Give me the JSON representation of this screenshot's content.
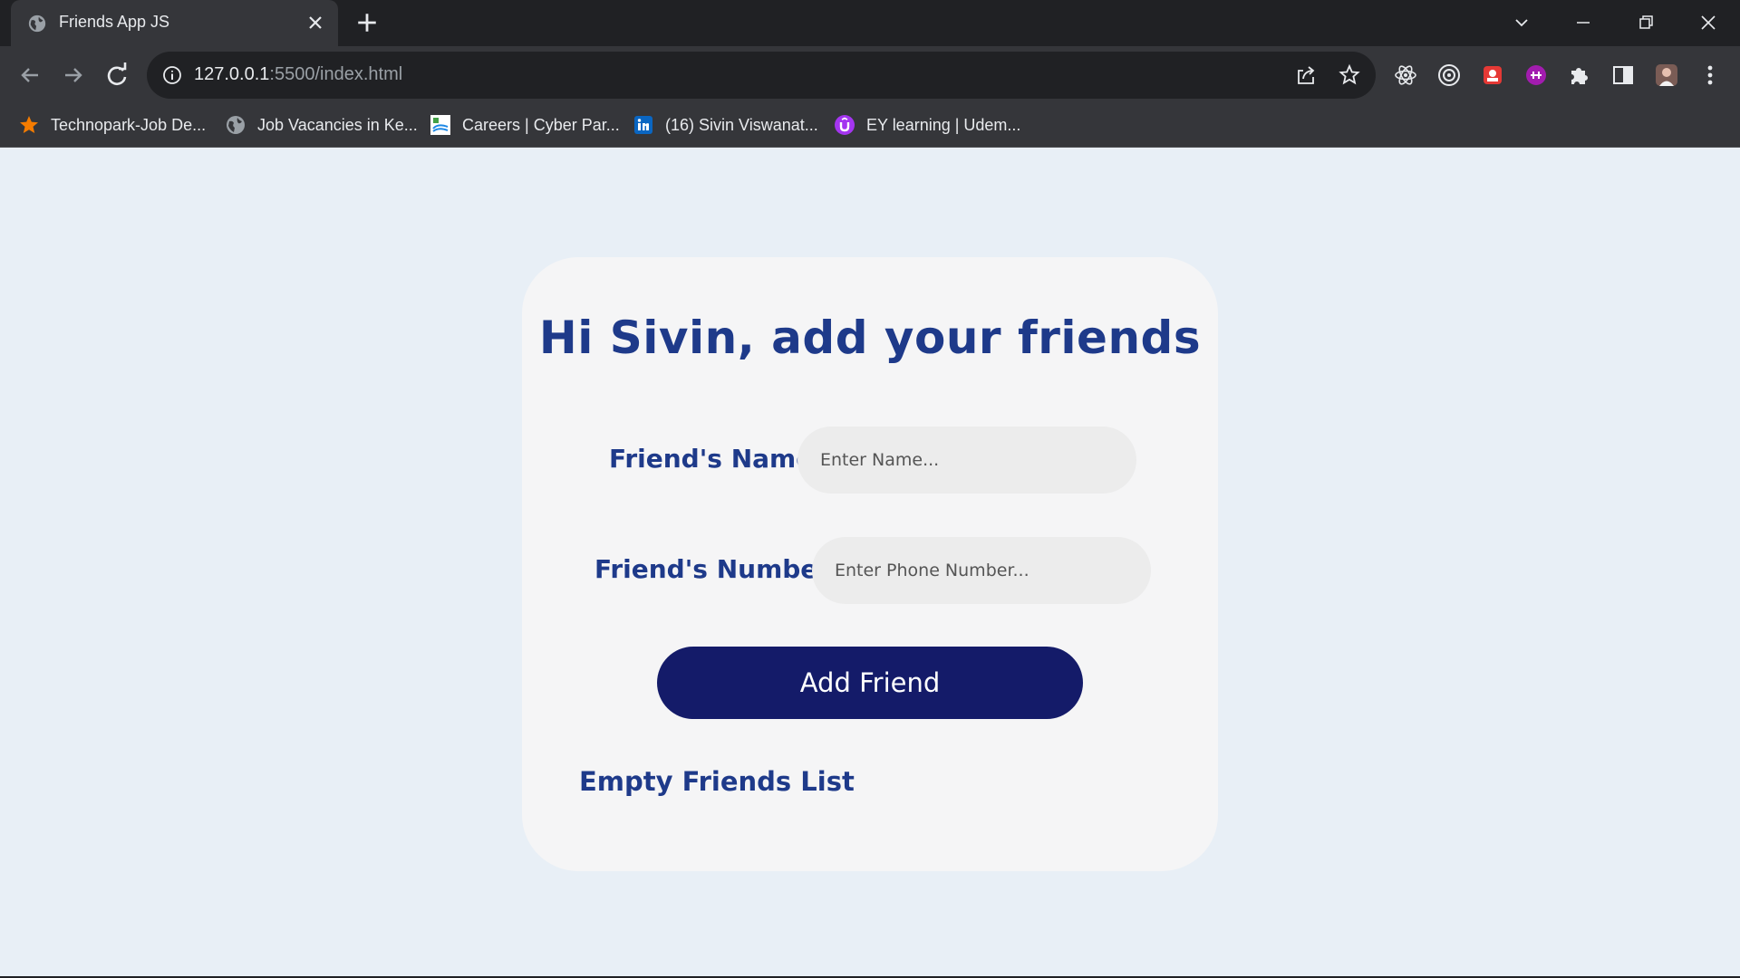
{
  "browser": {
    "tab_title": "Friends App JS",
    "url_host": "127.0.0.1",
    "url_rest": ":5500/index.html",
    "bookmarks": [
      {
        "label": "Technopark-Job De...",
        "icon": "star-icon"
      },
      {
        "label": "Job Vacancies in Ke...",
        "icon": "globe-icon"
      },
      {
        "label": "Careers | Cyber Par...",
        "icon": "cyberpark-icon"
      },
      {
        "label": "(16) Sivin Viswanat...",
        "icon": "linkedin-icon"
      },
      {
        "label": "EY learning | Udem...",
        "icon": "udemy-icon"
      }
    ]
  },
  "app": {
    "heading": "Hi Sivin, add your friends",
    "name_label": "Friend's Name",
    "name_placeholder": "Enter Name...",
    "number_label": "Friend's Number",
    "number_placeholder": "Enter Phone Number...",
    "add_button": "Add Friend",
    "empty_message": "Empty Friends List"
  },
  "colors": {
    "page_bg": "#e8eff6",
    "card_bg": "#f5f5f6",
    "heading": "#1e3a8a",
    "button_bg": "#141b69",
    "input_bg": "#ececec"
  }
}
